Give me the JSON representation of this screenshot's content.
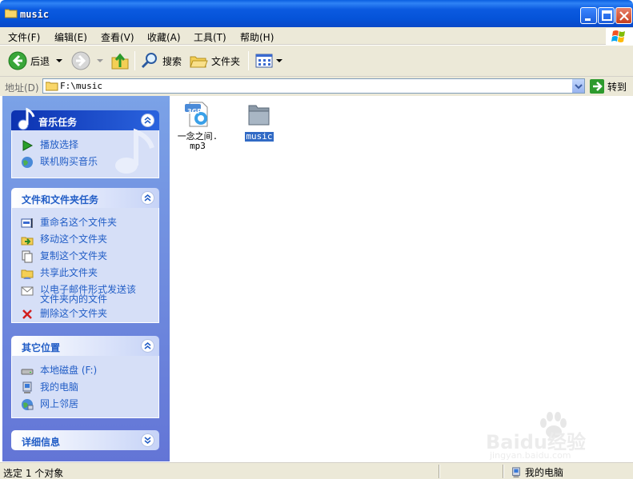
{
  "window": {
    "title": "music"
  },
  "menu": {
    "items": [
      "文件(F)",
      "编辑(E)",
      "查看(V)",
      "收藏(A)",
      "工具(T)",
      "帮助(H)"
    ]
  },
  "toolbar": {
    "back_label": "后退",
    "search_label": "搜索",
    "folders_label": "文件夹"
  },
  "address": {
    "label": "地址(D)",
    "value": "F:\\music",
    "go_label": "转到"
  },
  "left_pane": {
    "music_tasks": {
      "title": "音乐任务",
      "items": [
        "播放选择",
        "联机购买音乐"
      ]
    },
    "file_tasks": {
      "title": "文件和文件夹任务",
      "items": [
        "重命名这个文件夹",
        "移动这个文件夹",
        "复制这个文件夹",
        "共享此文件夹",
        "以电子邮件形式发送该文件夹内的文件",
        "删除这个文件夹"
      ]
    },
    "other_places": {
      "title": "其它位置",
      "items": [
        "本地磁盘 (F:)",
        "我的电脑",
        "网上邻居"
      ]
    },
    "details": {
      "title": "详细信息"
    }
  },
  "files": [
    {
      "name": "一念之间.mp3",
      "badge": "3GP",
      "icon": "video-file-icon",
      "selected": false
    },
    {
      "name": "music",
      "icon": "folder-icon",
      "selected": true
    }
  ],
  "status": {
    "left": "选定 1 个对象",
    "right": "我的电脑"
  },
  "watermark": {
    "brand": "Baidu经验",
    "url": "jingyan.baidu.com"
  },
  "colors": {
    "title_bar": "#0553d8",
    "task_link": "#215dc6",
    "selection": "#316ac5"
  }
}
